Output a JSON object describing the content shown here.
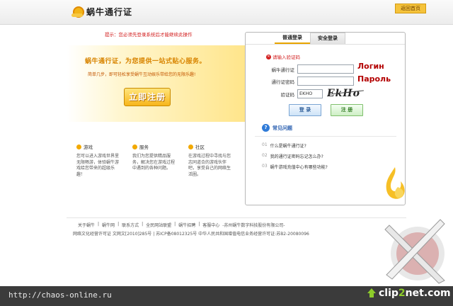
{
  "header": {
    "title": "蜗牛通行证",
    "home_button": "返回首页"
  },
  "notice": "提示：您必须先登录系统后才能继续此操作",
  "promo": {
    "title": "蜗牛通行证，为您提供一站式贴心服务。",
    "subtitle": "简单几步，即可轻松享受蜗牛互动娱乐带给您的无限乐趣!",
    "register_button": "立即注册"
  },
  "features": [
    {
      "title": "游戏",
      "body": "您可以进入游戏世界里无限畅游，体验蜗牛游戏给您带来的超级乐趣！"
    },
    {
      "title": "服务",
      "body": "我们为您提供精品服务，解决您在游戏过程中遇到的各种问题。"
    },
    {
      "title": "社区",
      "body": "在游戏过程中寻找与您志同道合的游戏伙伴吧，享受自己的网络生活圈。"
    }
  ],
  "login": {
    "tab_normal": "普通登录",
    "tab_secure": "安全登录",
    "error": "请输入验证码",
    "username_label": "蜗牛通行证",
    "password_label": "通行证密码",
    "captcha_label": "验证码",
    "captcha_value": "EKHO",
    "captcha_image_text": "EkHo",
    "login_button": "登 录",
    "register_button": "注 册",
    "annotation_login": "Логин",
    "annotation_password": "Пароль"
  },
  "faq": {
    "title": "常见问题",
    "items": [
      {
        "num": "01",
        "text": "什么是蜗牛通行证?"
      },
      {
        "num": "02",
        "text": "我的通行证密码忘记怎么办?"
      },
      {
        "num": "03",
        "text": "蜗牛游戏充值中心有哪些功能?"
      }
    ]
  },
  "footer": {
    "links": [
      "关于蜗牛",
      "蜗牛网",
      "联系方式",
      "全民网站联盟",
      "蜗牛招聘",
      "客服中心",
      "-苏州蜗牛数字科技股份有限公司-"
    ],
    "info": "网络文化经营许可证 文网文[2010]285号 | 苏ICP备08012325号 中华人民共和国增值电信业务经营许可证:苏B2-20080096"
  },
  "bottom": {
    "url": "http://chaos-online.ru",
    "brand_a": "clip",
    "brand_b": "2",
    "brand_c": "net.com"
  }
}
